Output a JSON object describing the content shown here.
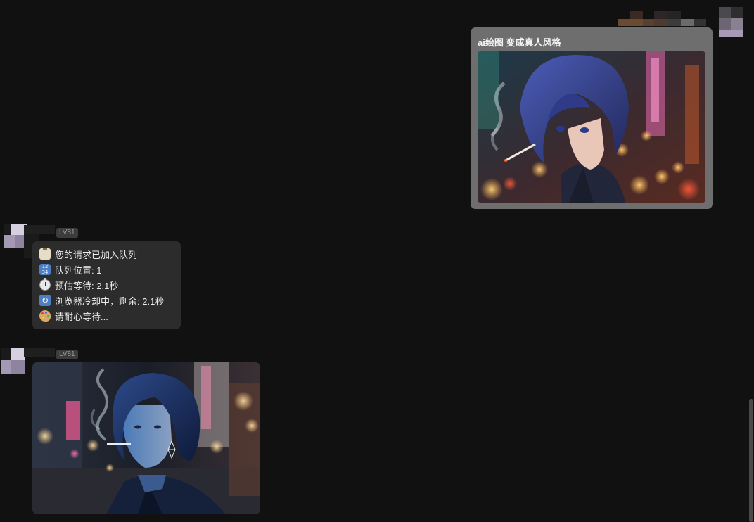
{
  "outgoing": {
    "text": "ai绘图 变成真人风格",
    "image_alt": "anime-style girl with short dark blue hair smoking, neon city night background"
  },
  "incoming": [
    {
      "level": "LV81",
      "status_lines": [
        {
          "icon": "clipboard-icon",
          "text": "您的请求已加入队列"
        },
        {
          "icon": "number-keys-icon",
          "text": "队列位置: 1"
        },
        {
          "icon": "stopwatch-icon",
          "text": "预估等待: 2.1秒"
        },
        {
          "icon": "refresh-icon",
          "text": "浏览器冷却中，剩余: 2.1秒"
        },
        {
          "icon": "palette-icon",
          "text": "请耐心等待..."
        }
      ]
    },
    {
      "level": "LV81",
      "image_alt": "realistic photo of woman with short blue hair smoking on neon-lit city street at night"
    }
  ],
  "colors": {
    "background": "#111111",
    "outgoing_bubble": "#6e6e6e",
    "incoming_bubble": "#2c2c2c",
    "level_badge": "#3c3c3c"
  }
}
